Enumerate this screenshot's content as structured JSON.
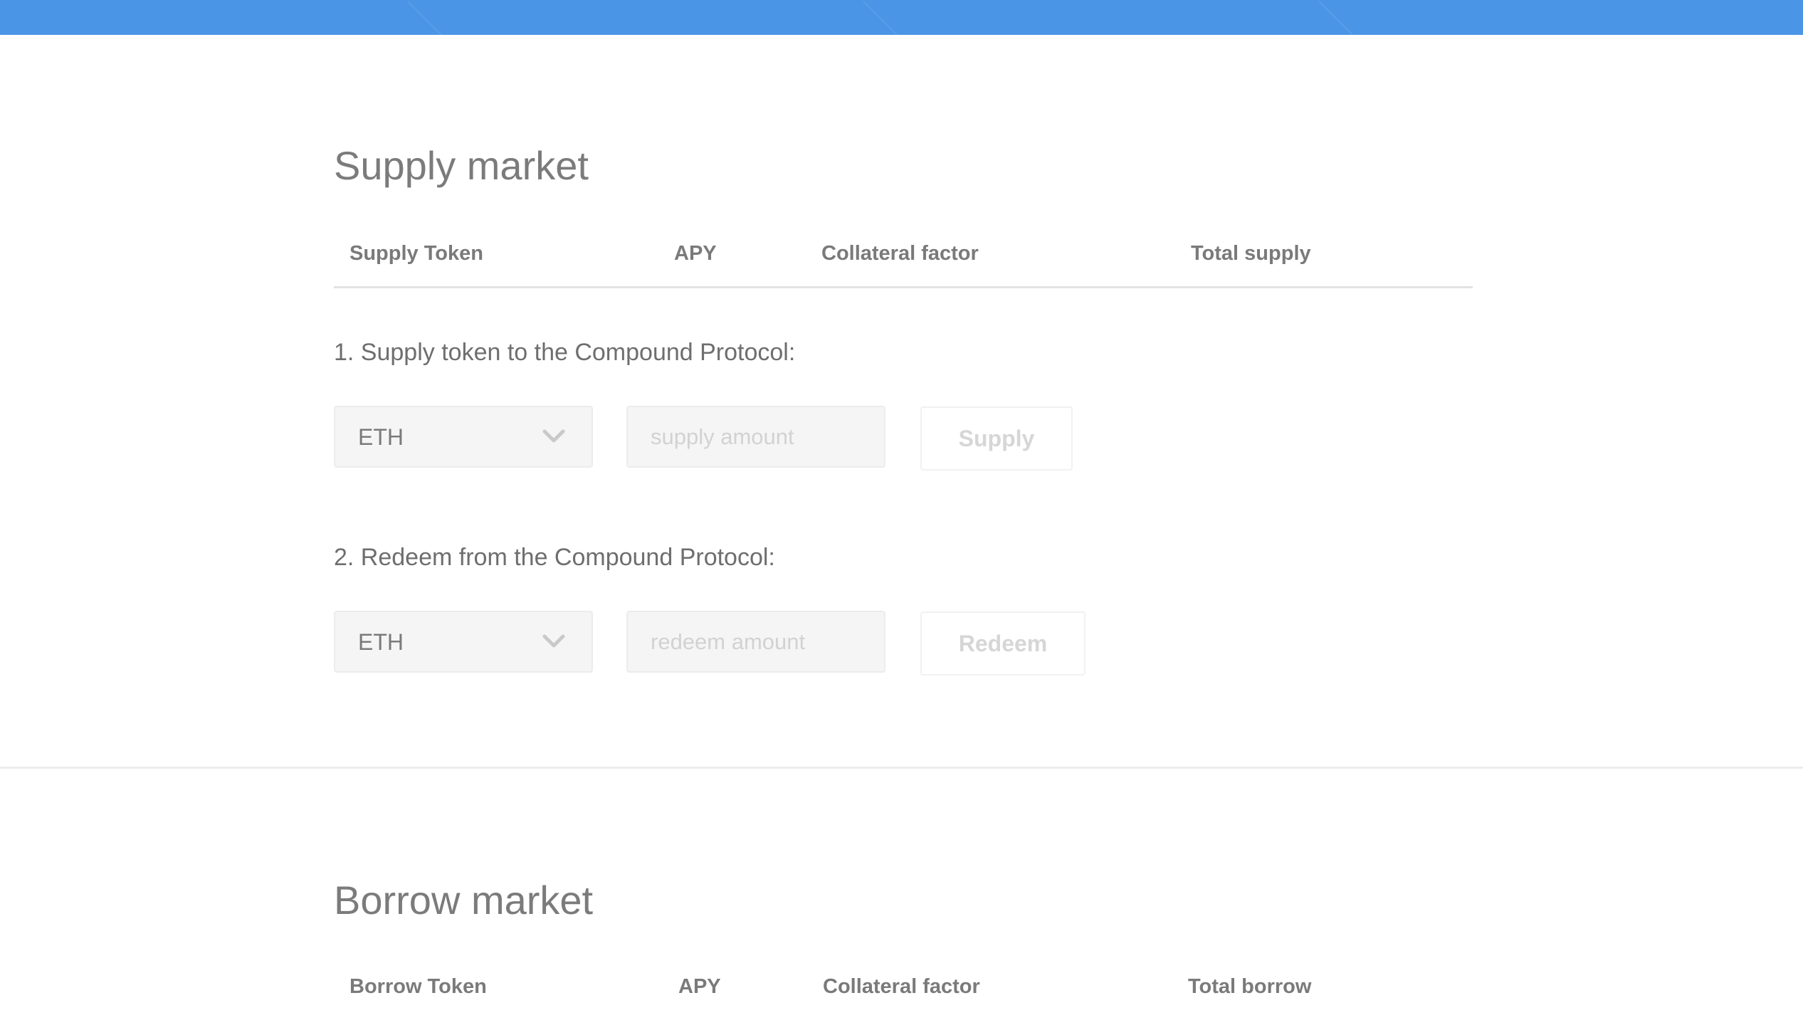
{
  "colors": {
    "top_bar": "#4a95e6",
    "text": "#7a7a7a",
    "placeholder": "#d2d2d2",
    "disabled_button_text": "#d6d6d6"
  },
  "supply_market": {
    "title": "Supply market",
    "columns": [
      "Supply Token",
      "APY",
      "Collateral factor",
      "Total supply"
    ],
    "supply_step": {
      "label": "1. Supply token to the Compound Protocol:",
      "token_selected": "ETH",
      "amount_placeholder": "supply amount",
      "button_label": "Supply"
    },
    "redeem_step": {
      "label": "2. Redeem from the Compound Protocol:",
      "token_selected": "ETH",
      "amount_placeholder": "redeem amount",
      "button_label": "Redeem"
    }
  },
  "borrow_market": {
    "title": "Borrow market",
    "columns": [
      "Borrow Token",
      "APY",
      "Collateral factor",
      "Total borrow"
    ]
  },
  "icons": {
    "dropdown": "chevron-down-icon"
  }
}
